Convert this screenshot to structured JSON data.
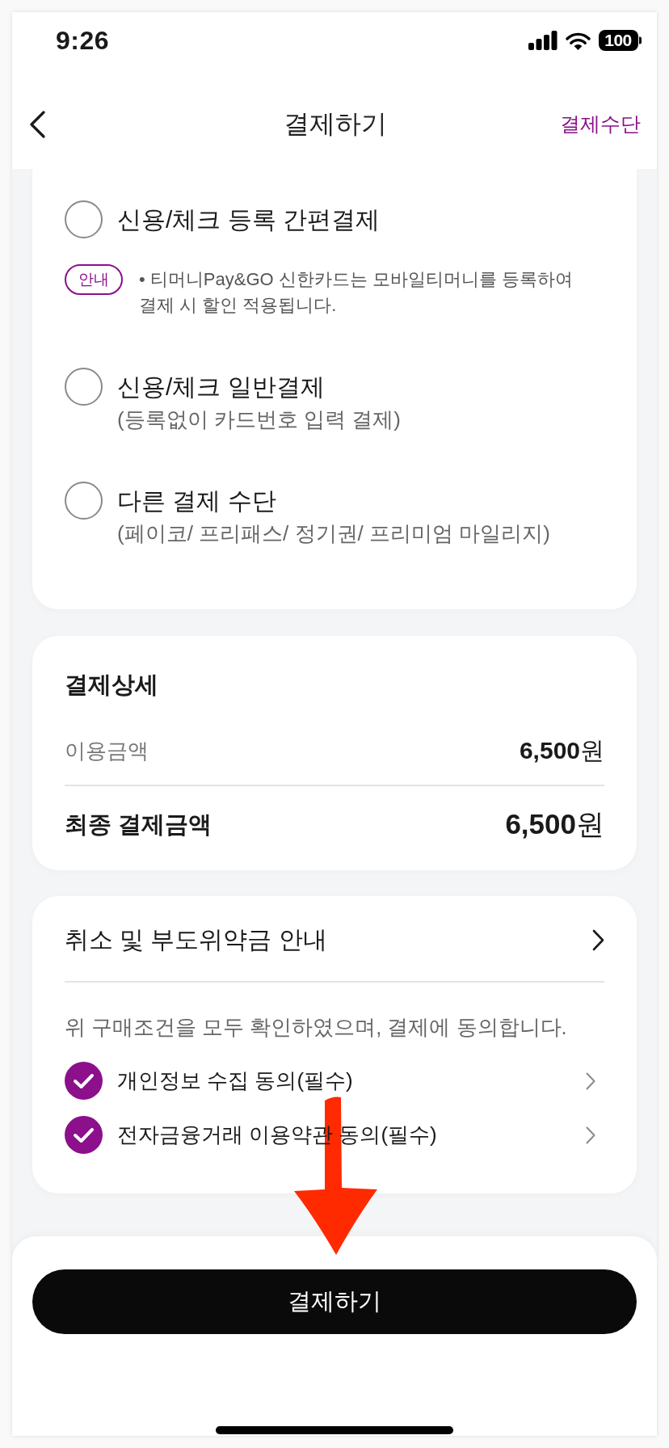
{
  "status_bar": {
    "time": "9:26",
    "battery": "100"
  },
  "nav_bar": {
    "title": "결제하기",
    "action": "결제수단"
  },
  "payment_methods": [
    {
      "label": "신용/체크 등록 간편결제",
      "selected": false,
      "notice": {
        "badge": "안내",
        "text": "• 티머니Pay&GO 신한카드는 모바일티머니를 등록하여 결제 시 할인 적용됩니다."
      }
    },
    {
      "label": "신용/체크 일반결제",
      "sublabel": "(등록없이 카드번호 입력 결제)",
      "selected": false
    },
    {
      "label": "다른 결제 수단",
      "sublabel": "(페이코/ 프리패스/ 정기권/ 프리미엄 마일리지)",
      "selected": false
    }
  ],
  "payment_details": {
    "title": "결제상세",
    "rows": [
      {
        "kind": "subtotal",
        "label": "이용금액",
        "amount": "**6,500**원"
      },
      {
        "kind": "total",
        "label": "최종 결제금액",
        "amount": "**6,500**원"
      }
    ]
  },
  "terms": {
    "link": "취소 및 부도위약금 안내",
    "statement": "위 구매조건을 모두 확인하였으며, 결제에 동의합니다.",
    "agreements": [
      {
        "label": "개인정보 수집 동의(필수)",
        "checked": true
      },
      {
        "label": "전자금융거래 이용약관 동의(필수)",
        "checked": true
      }
    ]
  },
  "submit_button": "결제하기"
}
